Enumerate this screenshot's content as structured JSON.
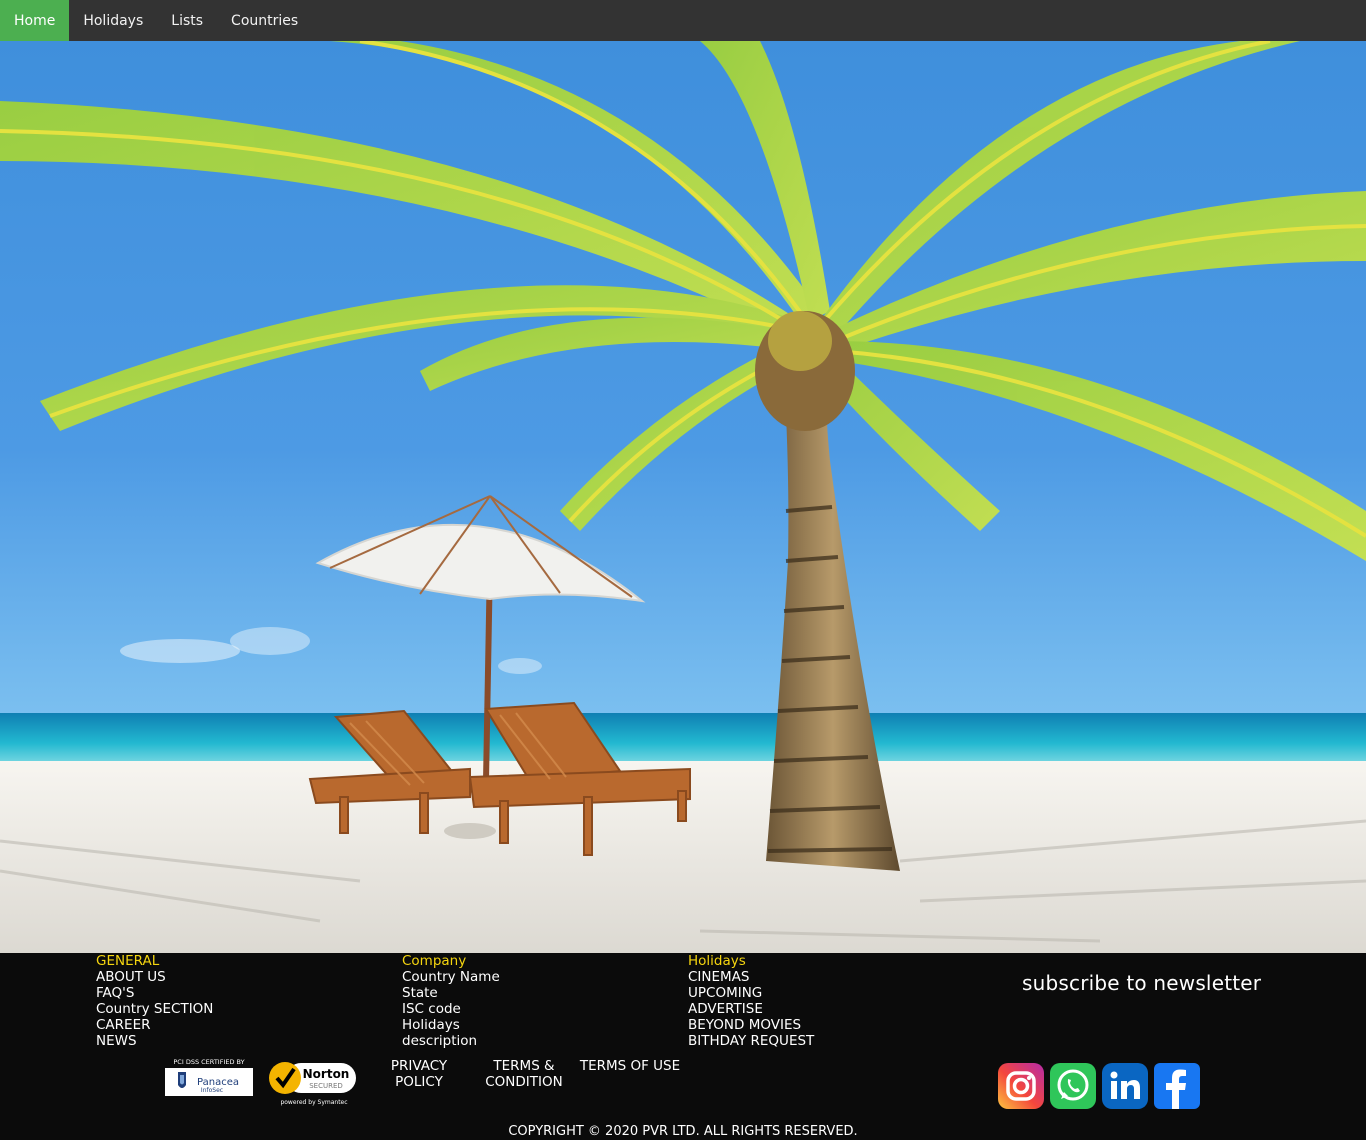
{
  "nav": {
    "items": [
      {
        "label": "Home",
        "active": true
      },
      {
        "label": "Holidays",
        "active": false
      },
      {
        "label": "Lists",
        "active": false
      },
      {
        "label": "Countries",
        "active": false
      }
    ]
  },
  "hero": {
    "image": "beach-palm-tree-loungers-umbrella"
  },
  "footer": {
    "general": {
      "heading": "GENERAL",
      "links": [
        "ABOUT US",
        "FAQ'S",
        "Country SECTION",
        "CAREER",
        "NEWS"
      ]
    },
    "company": {
      "heading": "Company",
      "links": [
        "Country Name",
        "State",
        "ISC code",
        "Holidays",
        "description"
      ]
    },
    "holidays": {
      "heading": "Holidays",
      "links": [
        "CINEMAS",
        "UPCOMING",
        "ADVERTISE",
        "BEYOND MOVIES",
        "BITHDAY REQUEST"
      ]
    },
    "newsletter_label": "subscribe to newsletter",
    "policies": {
      "privacy_line1": "PRIVACY",
      "privacy_line2": "POLICY",
      "terms_line1": "TERMS &",
      "terms_line2": "CONDITION",
      "terms_of_use": "TERMS OF USE"
    },
    "badges": {
      "pci_top": "PCI DSS CERTIFIED BY",
      "pci_name": "Panacea",
      "pci_sub": "InfoSec",
      "norton_name": "Norton",
      "norton_sub": "SECURED",
      "norton_powered": "powered by Symantec"
    },
    "social": [
      "instagram-icon",
      "whatsapp-icon",
      "linkedin-icon",
      "facebook-icon"
    ],
    "copyright": "COPYRIGHT © 2020 PVR LTD. ALL RIGHTS RESERVED.",
    "colors": {
      "heading": "#f5d50f",
      "nav_active": "#4caf50",
      "nav_bg": "#333333",
      "footer_bg": "#0b0b0b"
    }
  }
}
